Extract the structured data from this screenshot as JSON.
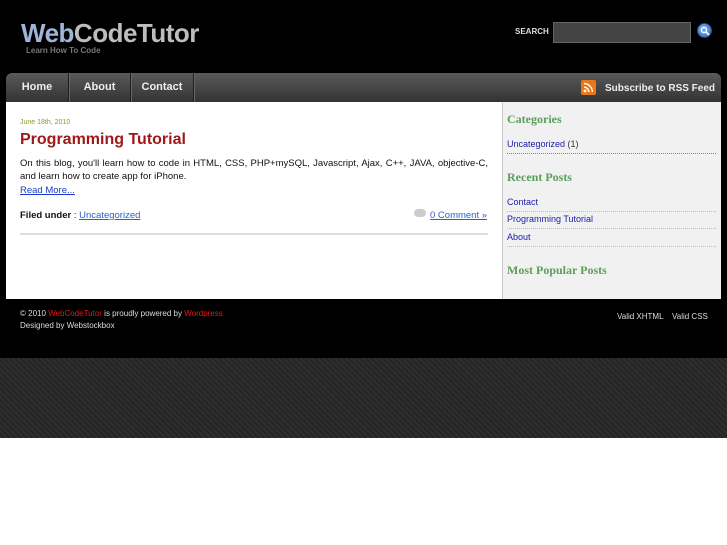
{
  "header": {
    "logo_part1": "Web",
    "logo_part2": "CodeTutor",
    "tagline": "Learn How To Code",
    "search_label": "SEARCH",
    "search_value": ""
  },
  "nav": {
    "items": [
      {
        "label": "Home"
      },
      {
        "label": "About"
      },
      {
        "label": "Contact"
      }
    ],
    "rss_label": "Subscribe to RSS Feed"
  },
  "post": {
    "date": "June 18th, 2010",
    "title": "Programming Tutorial",
    "body": "On this blog, you'll learn how to code in HTML, CSS, PHP+mySQL, Javascript, Ajax, C++, JAVA, objective-C, and learn how to create app for iPhone.",
    "read_more": "Read More...",
    "filed_under_label": "Filed under",
    "filed_sep": " : ",
    "category": "Uncategorized",
    "comments": "0 Comment »"
  },
  "sidebar": {
    "categories_heading": "Categories",
    "categories": [
      {
        "label": "Uncategorized",
        "count": " (1)"
      }
    ],
    "recent_heading": "Recent Posts",
    "recent": [
      {
        "label": "Contact"
      },
      {
        "label": "Programming Tutorial"
      },
      {
        "label": "About"
      }
    ],
    "popular_heading": "Most Popular Posts"
  },
  "footer": {
    "copyright": "© 2010 ",
    "site_name": "WebCodeTutor",
    "powered_by": " is proudly powered by ",
    "wordpress": "Wordpress",
    "designed_by": "Designed by Webstockbox",
    "valid_xhtml": "Valid XHTML",
    "valid_css": "Valid CSS"
  },
  "colors": {
    "background_dark": "#000000",
    "post_title": "#a01818",
    "date": "#8a9a2a",
    "sidebar_heading": "#5b9e5b",
    "rss_orange": "#e8781a"
  },
  "icons": {
    "search": "search-icon",
    "rss": "rss-icon",
    "comment": "comment-bubble-icon"
  }
}
